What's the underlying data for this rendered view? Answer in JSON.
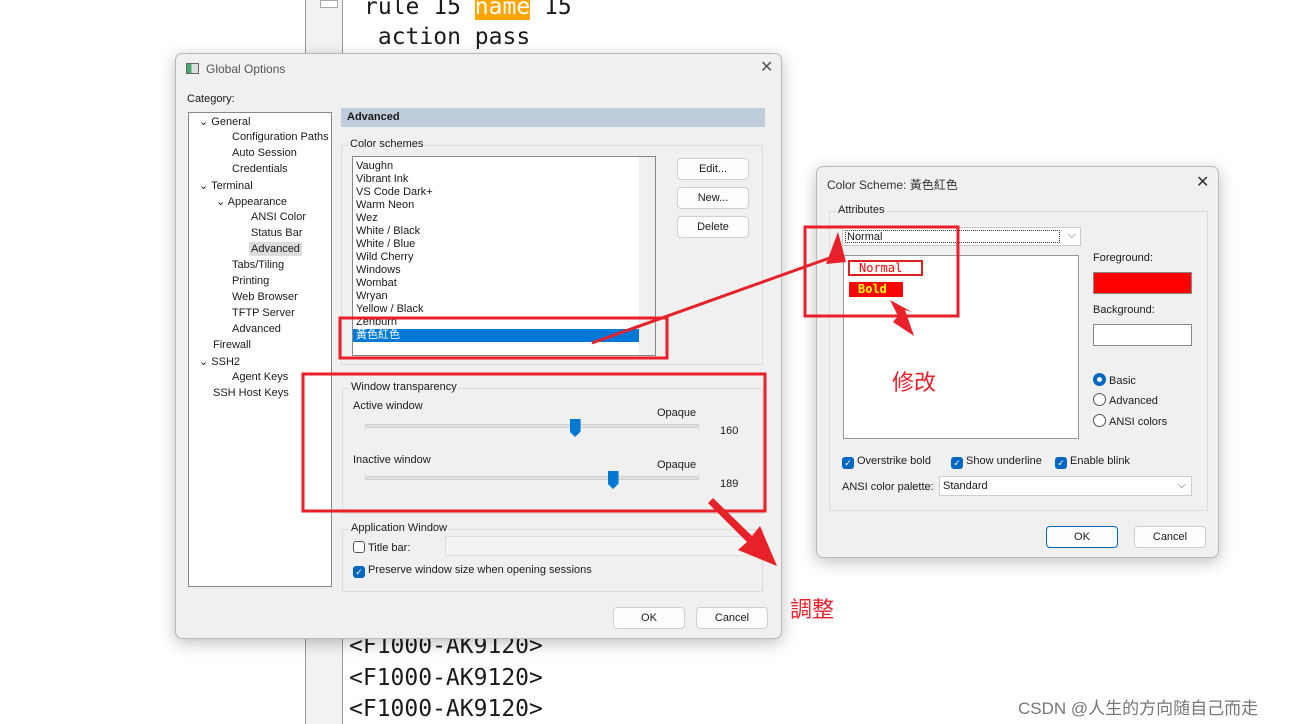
{
  "terminal": {
    "line1_a": "rule 15 ",
    "line1_hl": "name",
    "line1_b": " 15",
    "line2": " action pass",
    "bottom_lines": [
      "<F1000-AK9120>",
      "<F1000-AK9120>",
      "<F1000-AK9120>"
    ]
  },
  "global_options": {
    "title": "Global Options",
    "category_label": "Category:",
    "tree": [
      "General",
      "Configuration Paths",
      "Auto Session",
      "Credentials",
      "Terminal",
      "Appearance",
      "ANSI Color",
      "Status Bar",
      "Advanced",
      "Tabs/Tiling",
      "Printing",
      "Web Browser",
      "TFTP Server",
      "Advanced",
      "Firewall",
      "SSH2",
      "Agent Keys",
      "SSH Host Keys"
    ],
    "panel_title": "Advanced",
    "color_schemes_label": "Color schemes",
    "schemes": [
      "Vaughn",
      "Vibrant Ink",
      "VS Code Dark+",
      "Warm Neon",
      "Wez",
      "White / Black",
      "White / Blue",
      "Wild Cherry",
      "Windows",
      "Wombat",
      "Wryan",
      "Yellow / Black",
      "Zenburn",
      "黃色紅色"
    ],
    "selected_scheme": "黃色紅色",
    "edit": "Edit...",
    "new": "New...",
    "delete": "Delete",
    "transparency_label": "Window transparency",
    "active_label": "Active window",
    "inactive_label": "Inactive window",
    "opaque": "Opaque",
    "active_value": "160",
    "inactive_value": "189",
    "slider_max": 255,
    "app_window_label": "Application Window",
    "title_bar": "Title bar:",
    "preserve": "Preserve window size when opening sessions",
    "ok": "OK",
    "cancel": "Cancel"
  },
  "color_scheme": {
    "title": "Color Scheme: 黃色紅色",
    "attributes": "Attributes",
    "attr_select": "Normal",
    "preview_normal": "Normal",
    "preview_bold": "Bold",
    "foreground": "Foreground:",
    "background": "Background:",
    "fg_color": "#ff0000",
    "bg_color": "#ffffff",
    "radios": [
      "Basic",
      "Advanced",
      "ANSI colors"
    ],
    "overstrike": "Overstrike bold",
    "underline": "Show underline",
    "blink": "Enable blink",
    "palette_label": "ANSI color palette:",
    "palette_value": "Standard",
    "ok": "OK",
    "cancel": "Cancel"
  },
  "annotations": {
    "modify": "修改",
    "adjust": "調整"
  },
  "watermark": "CSDN @人生的方向随自己而走"
}
